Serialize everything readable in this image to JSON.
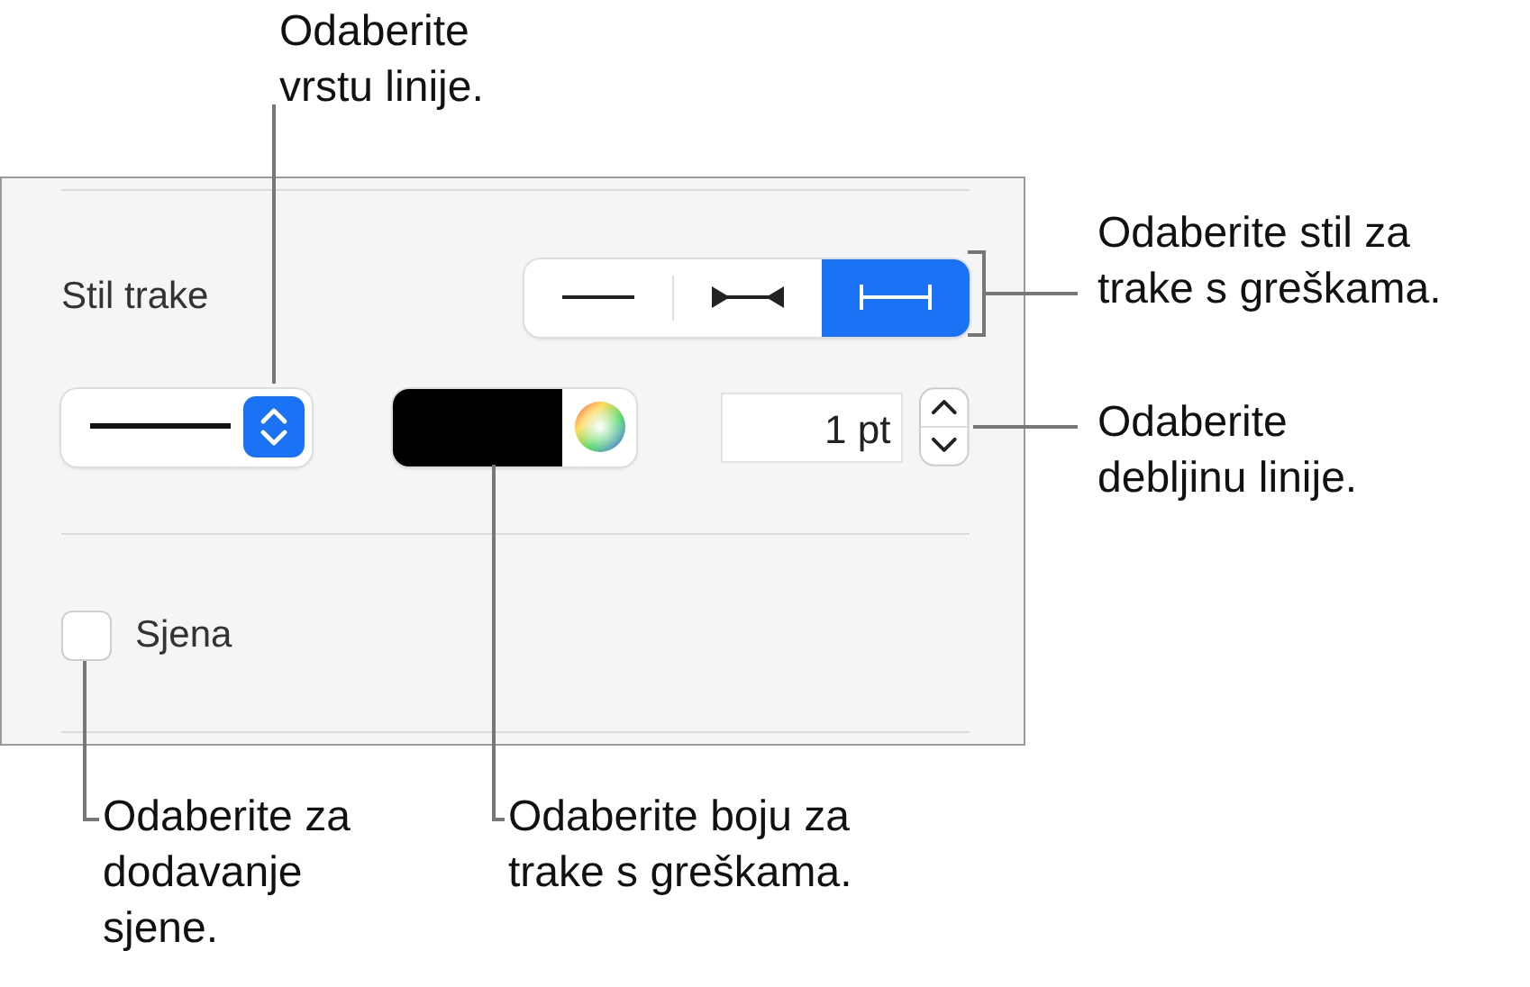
{
  "panel": {
    "bar_style": {
      "label": "Stil trake",
      "segments": [
        {
          "kind": "plain",
          "selected": false
        },
        {
          "kind": "caps-in",
          "selected": false
        },
        {
          "kind": "caps-out",
          "selected": true
        }
      ]
    },
    "thickness": {
      "value": "1 pt"
    },
    "shadow": {
      "label": "Sjena",
      "checked": false
    }
  },
  "callouts": [
    {
      "text": "Odaberite\nvrstu linije."
    },
    {
      "text": "Odaberite stil za\ntrake s greškama."
    },
    {
      "text": "Odaberite\ndebljinu linije."
    },
    {
      "text": "Odaberite za\ndodavanje\nsjene."
    },
    {
      "text": "Odaberite boju za\ntrake s greškama."
    }
  ]
}
